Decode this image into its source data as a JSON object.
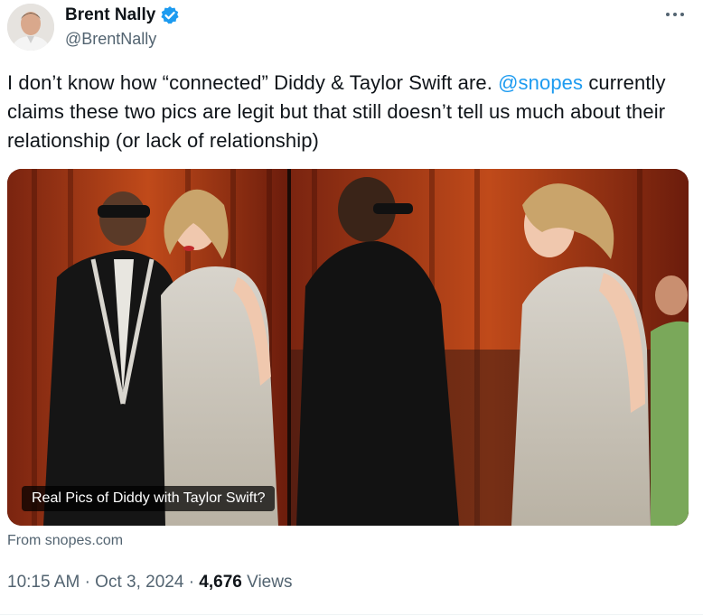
{
  "author": {
    "display_name": "Brent Nally",
    "handle": "@BrentNally",
    "verified_icon": "verified-badge-icon",
    "avatar_alt": "avatar"
  },
  "tweet": {
    "text_before_mention": "I don’t know how “connected” Diddy & Taylor Swift are. ",
    "mention": "@snopes",
    "text_after_mention": " currently claims these two pics are legit but that still doesn’t tell us much about their relationship (or lack of relationship)"
  },
  "card": {
    "caption": "Real Pics of Diddy with Taylor Swift?",
    "source": "From snopes.com"
  },
  "meta": {
    "time": "10:15 AM",
    "date": "Oct 3, 2024",
    "views_count": "4,676",
    "views_label": "Views"
  },
  "colors": {
    "accent": "#1d9bf0",
    "text": "#0f1419",
    "secondary": "#536471"
  },
  "icons": {
    "more": "more-options-icon"
  }
}
